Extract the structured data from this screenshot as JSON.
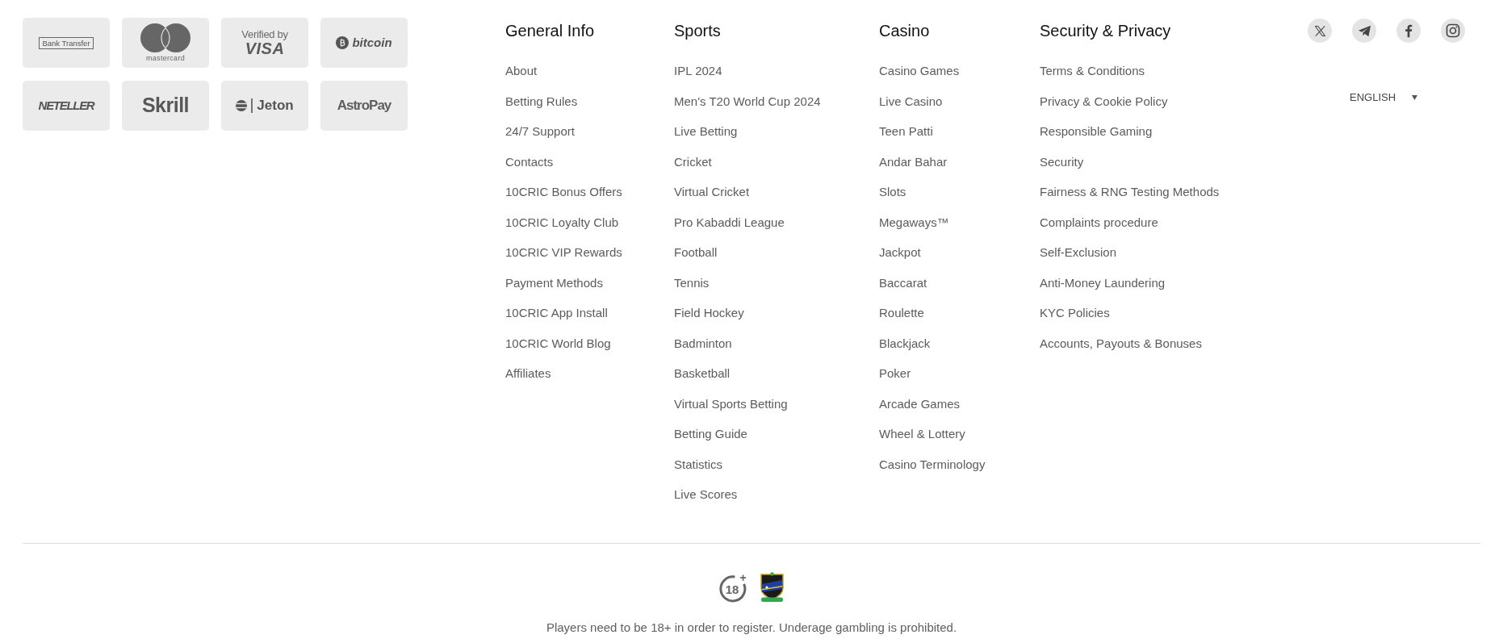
{
  "payment_methods": [
    {
      "kind": "bank_transfer",
      "text": "Bank Transfer"
    },
    {
      "kind": "mastercard",
      "text": "mastercard"
    },
    {
      "kind": "visa",
      "caption": "Verified by",
      "text": "VISA"
    },
    {
      "kind": "bitcoin",
      "text": "bitcoin"
    },
    {
      "kind": "neteller",
      "text": "NETELLER"
    },
    {
      "kind": "skrill",
      "text": "Skrill"
    },
    {
      "kind": "jeton",
      "text": "Jeton"
    },
    {
      "kind": "astropay",
      "text": "AstroPay"
    }
  ],
  "link_columns": [
    {
      "title": "General Info",
      "links": [
        "About",
        "Betting Rules",
        "24/7 Support",
        "Contacts",
        "10CRIC Bonus Offers",
        "10CRIC Loyalty Club",
        "10CRIC VIP Rewards",
        "Payment Methods",
        "10CRIC App Install",
        "10CRIC World Blog",
        "Affiliates"
      ]
    },
    {
      "title": "Sports",
      "links": [
        "IPL 2024",
        "Men's T20 World Cup 2024",
        "Live Betting",
        "Cricket",
        "Virtual Cricket",
        "Pro Kabaddi League",
        "Football",
        "Tennis",
        "Field Hockey",
        "Badminton",
        "Basketball",
        "Virtual Sports Betting",
        "Betting Guide",
        "Statistics",
        "Live Scores"
      ]
    },
    {
      "title": "Casino",
      "links": [
        "Casino Games",
        "Live Casino",
        "Teen Patti",
        "Andar Bahar",
        "Slots",
        "Megaways™",
        "Jackpot",
        "Baccarat",
        "Roulette",
        "Blackjack",
        "Poker",
        "Arcade Games",
        "Wheel & Lottery",
        "Casino Terminology"
      ]
    },
    {
      "title": "Security & Privacy",
      "links": [
        "Terms & Conditions",
        "Privacy & Cookie Policy",
        "Responsible Gaming",
        "Security",
        "Fairness & RNG Testing Methods",
        "Complaints procedure",
        "Self-Exclusion",
        "Anti-Money Laundering",
        "KYC Policies",
        "Accounts, Payouts & Bonuses"
      ]
    }
  ],
  "social_links": [
    {
      "kind": "x"
    },
    {
      "kind": "telegram"
    },
    {
      "kind": "facebook"
    },
    {
      "kind": "instagram"
    }
  ],
  "language_selector": {
    "label": "ENGLISH"
  },
  "age_badge": {
    "number": "18",
    "plus": "+"
  },
  "disclaimer": "Players need to be 18+ in order to register. Underage gambling is prohibited."
}
